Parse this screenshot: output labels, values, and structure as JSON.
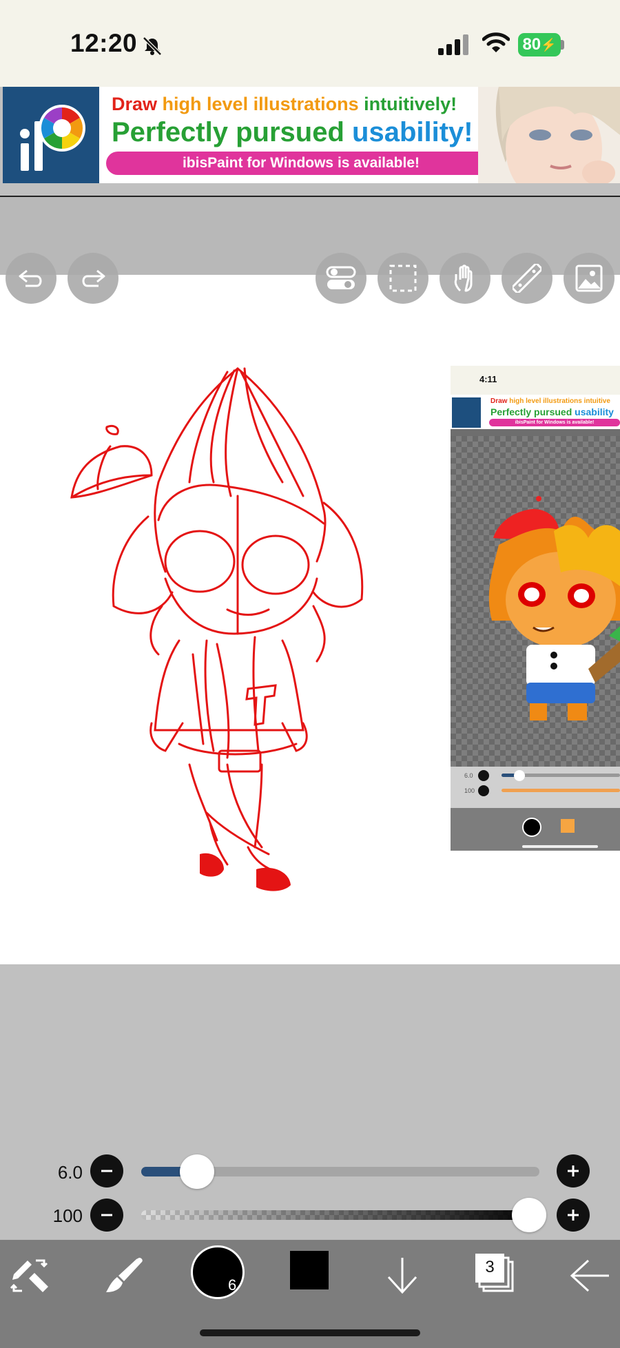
{
  "status_bar": {
    "time": "12:20",
    "battery": "80"
  },
  "ad": {
    "line1_a": "Draw",
    "line1_b": "high level illustrations",
    "line1_c": "intuitively!",
    "line2_a": "Perfectly pursued",
    "line2_b": "usability!",
    "pill": "ibisPaint for Windows is available!",
    "colors": {
      "red": "#e2231a",
      "orange": "#f29a10",
      "green": "#27a035",
      "blue": "#1b8ed8",
      "pink": "#e0349c"
    }
  },
  "thumbnail": {
    "time": "4:11",
    "line1_a": "Draw",
    "line1_b": "high level illustrations intuitive",
    "line2_a": "Perfectly pursued",
    "line2_b": "usability",
    "pill": "ibisPaint for Windows is available!",
    "size_label": "6.0",
    "opacity_label": "100"
  },
  "toolbar": {
    "undo_icon": "undo-icon",
    "redo_icon": "redo-icon",
    "icons": [
      "toggle-icon",
      "selection-icon",
      "hand-icon",
      "ruler-icon",
      "image-icon"
    ]
  },
  "sliders": {
    "size": {
      "label": "6.0",
      "value_fraction": 0.14
    },
    "opacity": {
      "label": "100",
      "value_fraction": 1.0
    }
  },
  "bottom_bar": {
    "brush_size_badge": "6",
    "layers_count": "3",
    "color_primary": "#000000",
    "accent": "#2a4f7a"
  }
}
